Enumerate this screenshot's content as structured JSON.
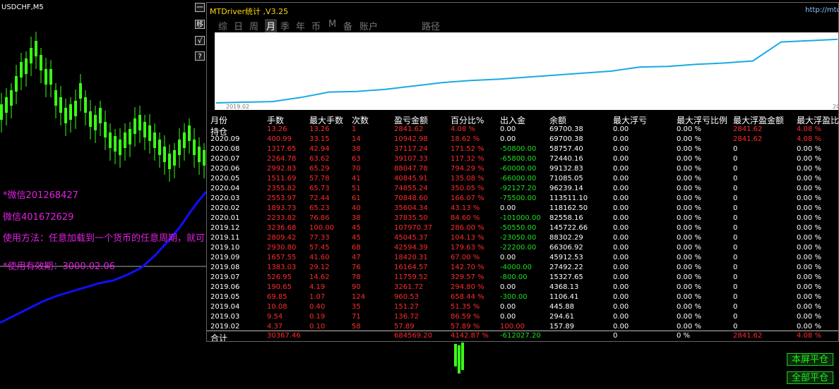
{
  "chart": {
    "symbol": "USDCHF,M5",
    "side_buttons": [
      "一",
      "移",
      "√",
      "?"
    ],
    "wechat1": "*微信201268427",
    "wechat2": "微信401672629",
    "usage": "使用方法：任意加载到一个货币的任意周期，就可以",
    "expiry": "*使用有效期：3000.02.06"
  },
  "panel": {
    "title": "MTDriver统计 ,V3.25",
    "url": "http://mtdr",
    "tabs": [
      "综",
      "日",
      "周",
      "月",
      "季",
      "年",
      "币",
      "M",
      "备",
      "账户",
      "路径"
    ],
    "selected_tab": "月",
    "equity_axis": [
      "2019.02",
      "20"
    ],
    "equity_curve": [
      0.0,
      0.01,
      0.02,
      0.08,
      0.16,
      0.17,
      0.2,
      0.25,
      0.3,
      0.33,
      0.35,
      0.38,
      0.41,
      0.44,
      0.47,
      0.53,
      0.54,
      0.57,
      0.59,
      0.62,
      0.9,
      0.92,
      0.94
    ],
    "columns": [
      "月份",
      "手数",
      "最大手数",
      "次数",
      "盈亏金额",
      "百分比%",
      "出入金",
      "余额",
      "最大浮亏",
      "最大浮亏比例",
      "最大浮盈金额",
      "最大浮盈比"
    ],
    "rows": [
      [
        "持仓",
        "13.26",
        "13.26",
        "1",
        "2841.62",
        "4.08 %",
        "0.00",
        "69700.38",
        "0.00",
        "0.00 %",
        "2841.62",
        "4.08 %"
      ],
      [
        "2020.09",
        "400.99",
        "33.15",
        "14",
        "10942.98",
        "18.62 %",
        "0.00",
        "69700.38",
        "0.00",
        "0.00 %",
        "2841.62",
        "4.08 %"
      ],
      [
        "2020.08",
        "1317.65",
        "42.94",
        "38",
        "37117.24",
        "171.52 %",
        "-50800.00",
        "58757.40",
        "0.00",
        "0.00 %",
        "0",
        "0.00 %"
      ],
      [
        "2020.07",
        "2264.78",
        "63.62",
        "63",
        "39107.33",
        "117.32 %",
        "-65800.00",
        "72440.16",
        "0.00",
        "0.00 %",
        "0",
        "0.00 %"
      ],
      [
        "2020.06",
        "2992.83",
        "65.29",
        "70",
        "88047.78",
        "794.29 %",
        "-60000.00",
        "99132.83",
        "0.00",
        "0.00 %",
        "0",
        "0.00 %"
      ],
      [
        "2020.05",
        "1511.69",
        "57.78",
        "41",
        "40845.91",
        "135.08 %",
        "-66000.00",
        "71085.05",
        "0.00",
        "0.00 %",
        "0",
        "0.00 %"
      ],
      [
        "2020.04",
        "2355.82",
        "65.73",
        "51",
        "74855.24",
        "350.05 %",
        "-92127.20",
        "96239.14",
        "0.00",
        "0.00 %",
        "0",
        "0.00 %"
      ],
      [
        "2020.03",
        "2553.97",
        "72.44",
        "61",
        "70848.60",
        "166.07 %",
        "-75500.00",
        "113511.10",
        "0.00",
        "0.00 %",
        "0",
        "0.00 %"
      ],
      [
        "2020.02",
        "1893.73",
        "65.23",
        "40",
        "35604.34",
        "43.13 %",
        "0.00",
        "118162.50",
        "0.00",
        "0.00 %",
        "0",
        "0.00 %"
      ],
      [
        "2020.01",
        "2233.82",
        "76.86",
        "38",
        "37835.50",
        "84.60 %",
        "-101000.00",
        "82558.16",
        "0.00",
        "0.00 %",
        "0",
        "0.00 %"
      ],
      [
        "2019.12",
        "3236.68",
        "100.00",
        "45",
        "107970.37",
        "286.00 %",
        "-50550.00",
        "145722.66",
        "0.00",
        "0.00 %",
        "0",
        "0.00 %"
      ],
      [
        "2019.11",
        "2809.42",
        "77.33",
        "45",
        "45045.37",
        "104.13 %",
        "-23050.00",
        "88302.29",
        "0.00",
        "0.00 %",
        "0",
        "0.00 %"
      ],
      [
        "2019.10",
        "2930.80",
        "57.45",
        "68",
        "42594.39",
        "179.63 %",
        "-22200.00",
        "66306.92",
        "0.00",
        "0.00 %",
        "0",
        "0.00 %"
      ],
      [
        "2019.09",
        "1657.55",
        "41.60",
        "47",
        "18420.31",
        "67.00 %",
        "0.00",
        "45912.53",
        "0.00",
        "0.00 %",
        "0",
        "0.00 %"
      ],
      [
        "2019.08",
        "1383.03",
        "29.12",
        "76",
        "16164.57",
        "142.70 %",
        "-4000.00",
        "27492.22",
        "0.00",
        "0.00 %",
        "0",
        "0.00 %"
      ],
      [
        "2019.07",
        "526.95",
        "14.62",
        "78",
        "11759.52",
        "329.57 %",
        "-800.00",
        "15327.65",
        "0.00",
        "0.00 %",
        "0",
        "0.00 %"
      ],
      [
        "2019.06",
        "190.65",
        "4.19",
        "90",
        "3261.72",
        "294.80 %",
        "0.00",
        "4368.13",
        "0.00",
        "0.00 %",
        "0",
        "0.00 %"
      ],
      [
        "2019.05",
        "69.85",
        "1.07",
        "124",
        "960.53",
        "658.44 %",
        "-300.00",
        "1106.41",
        "0.00",
        "0.00 %",
        "0",
        "0.00 %"
      ],
      [
        "2019.04",
        "10.08",
        "0.40",
        "35",
        "151.27",
        "51.35 %",
        "0.00",
        "445.88",
        "0.00",
        "0.00 %",
        "0",
        "0.00 %"
      ],
      [
        "2019.03",
        "9.54",
        "0.19",
        "71",
        "136.72",
        "86.59 %",
        "0.00",
        "294.61",
        "0.00",
        "0.00 %",
        "0",
        "0.00 %"
      ],
      [
        "2019.02",
        "4.37",
        "0.10",
        "58",
        "57.89",
        "57.89 %",
        "100.00",
        "157.89",
        "0.00",
        "0.00 %",
        "0",
        "0.00 %"
      ]
    ],
    "total": [
      "合计",
      "30367.46",
      "",
      "",
      "684569.20",
      "4142.87 %",
      "-612027.20",
      "",
      "0",
      "0 %",
      "2841.62",
      "4.08 %"
    ]
  },
  "buttons": {
    "close_screen": "本屏平仓",
    "close_all": "全部平仓"
  },
  "colors": {
    "loss": "#ff2a2a",
    "gain": "#1ee01e",
    "curve": "#19a9e6",
    "title": "#ffd700",
    "bull_candle": "#39ff14",
    "indicator": "#1010ff",
    "wechat": "#e020e0"
  }
}
